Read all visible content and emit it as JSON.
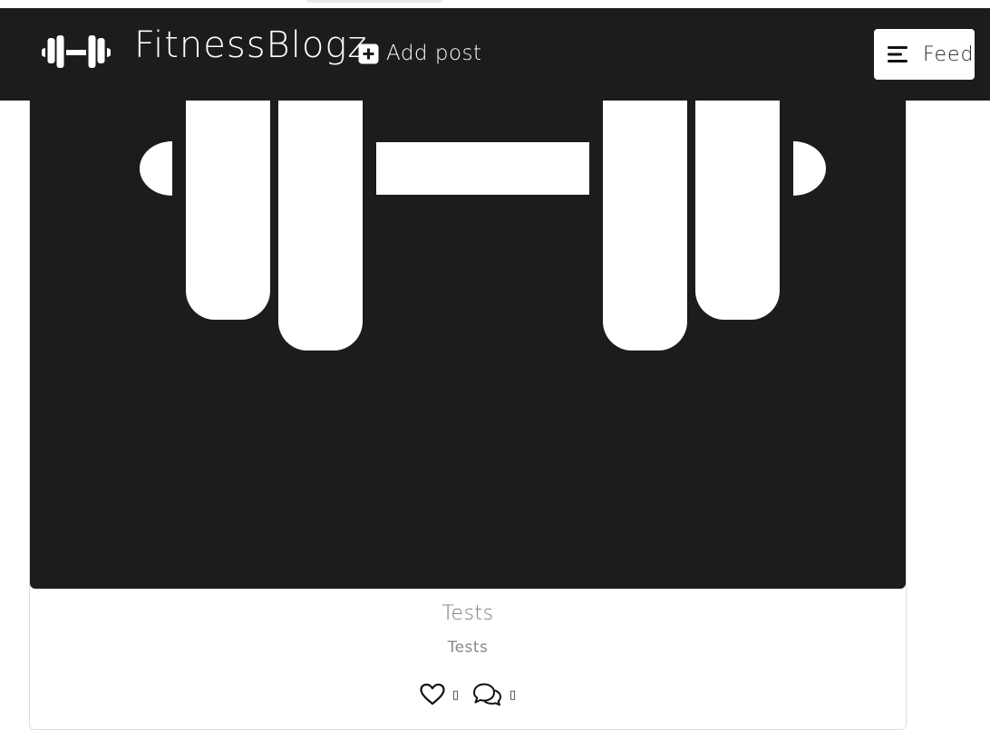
{
  "navbar": {
    "brand_name": "FitnessBlogz",
    "logo_icon": "dumbbell-icon",
    "add_post_label": "Add post",
    "add_post_icon": "plus-square-icon",
    "feed_label": "Feed",
    "feed_icon": "menu-icon",
    "background_color": "#1c1c1c"
  },
  "post": {
    "image_icon": "dumbbell-icon",
    "title": "Tests",
    "subtitle": "Tests",
    "like_icon": "heart-icon",
    "like_count": "▯",
    "comment_icon": "comments-icon",
    "comment_count": "▯"
  }
}
